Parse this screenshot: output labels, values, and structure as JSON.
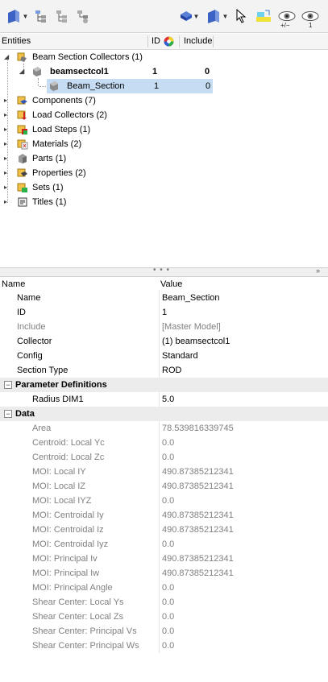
{
  "tree_header": {
    "entities": "Entities",
    "id": "ID",
    "include": "Include"
  },
  "tree": {
    "beam_section_collectors": "Beam Section Collectors (1)",
    "collector_name": "beamsectcol1",
    "collector_id": "1",
    "collector_include": "0",
    "section_name": "Beam_Section",
    "section_id": "1",
    "section_include": "0",
    "components": "Components (7)",
    "load_collectors": "Load Collectors (2)",
    "load_steps": "Load Steps (1)",
    "materials": "Materials (2)",
    "parts": "Parts (1)",
    "properties": "Properties (2)",
    "sets": "Sets (1)",
    "titles": "Titles (1)"
  },
  "toolbar": {
    "eye_plus_minus": "+/−",
    "eye_count": "1"
  },
  "splitter": {
    "dots": "• • •",
    "collapse": "»"
  },
  "props_header": {
    "name": "Name",
    "value": "Value"
  },
  "props": [
    {
      "name": "Name",
      "value": "Beam_Section"
    },
    {
      "name": "ID",
      "value": "1"
    },
    {
      "name": "Include",
      "value": "[Master Model]"
    },
    {
      "name": "Collector",
      "value": "(1) beamsectcol1"
    },
    {
      "name": "Config",
      "value": "Standard"
    },
    {
      "name": "Section Type",
      "value": "ROD"
    }
  ],
  "param_section": {
    "toggle": "−",
    "title": "Parameter Definitions",
    "rows": [
      {
        "name": "Radius DIM1",
        "value": "5.0"
      }
    ]
  },
  "data_section": {
    "toggle": "−",
    "title": "Data",
    "rows": [
      {
        "name": "Area",
        "value": "78.539816339745"
      },
      {
        "name": "Centroid: Local Yc",
        "value": "0.0"
      },
      {
        "name": "Centroid: Local Zc",
        "value": "0.0"
      },
      {
        "name": "MOI: Local IY",
        "value": "490.87385212341"
      },
      {
        "name": "MOI: Local IZ",
        "value": "490.87385212341"
      },
      {
        "name": "MOI: Local IYZ",
        "value": "0.0"
      },
      {
        "name": "MOI: Centroidal Iy",
        "value": "490.87385212341"
      },
      {
        "name": "MOI: Centroidal Iz",
        "value": "490.87385212341"
      },
      {
        "name": "MOI: Centroidal Iyz",
        "value": "0.0"
      },
      {
        "name": "MOI: Principal Iv",
        "value": "490.87385212341"
      },
      {
        "name": "MOI: Principal Iw",
        "value": "490.87385212341"
      },
      {
        "name": "MOI: Principal Angle",
        "value": "0.0"
      },
      {
        "name": "Shear Center: Local Ys",
        "value": "0.0"
      },
      {
        "name": "Shear Center: Local Zs",
        "value": "0.0"
      },
      {
        "name": "Shear Center: Principal Vs",
        "value": "0.0"
      },
      {
        "name": "Shear Center: Principal Ws",
        "value": "0.0"
      }
    ]
  },
  "colors": {
    "selection": "#c5dcf2",
    "section_bg": "#ececec",
    "readonly_text": "#808080"
  }
}
